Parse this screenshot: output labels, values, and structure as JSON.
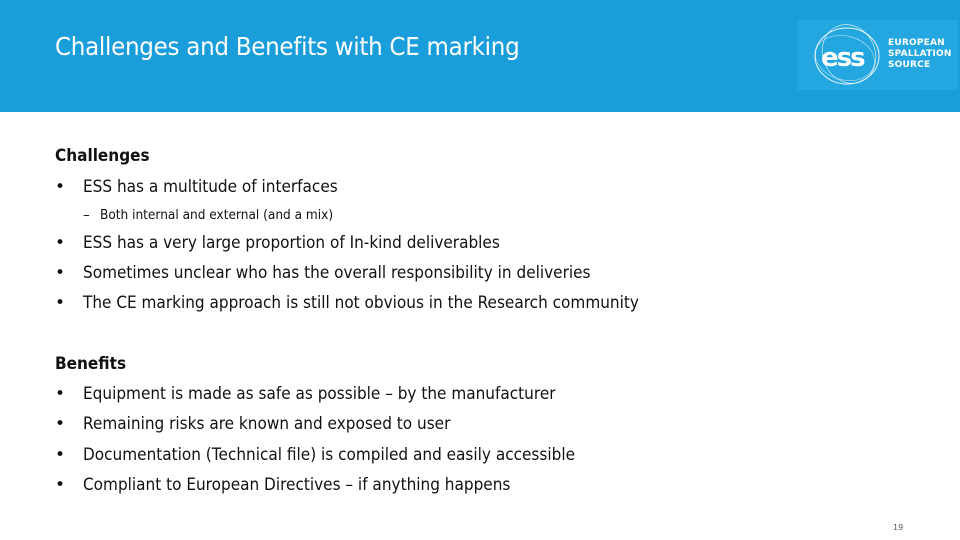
{
  "slide": {
    "title": "Challenges and Benefits with CE marking",
    "page_number": "19",
    "colors": {
      "header_bg": "#1a9edb",
      "logo_bg": "#24a6e0",
      "text": "#111111"
    }
  },
  "logo": {
    "mark": "ess",
    "lines": [
      "EUROPEAN",
      "SPALLATION",
      "SOURCE"
    ]
  },
  "challenges": {
    "heading": "Challenges",
    "items": [
      {
        "text": "ESS has a multitude of interfaces",
        "sub": [
          "Both internal and external (and a mix)"
        ]
      },
      {
        "text": "ESS has a very large proportion of In-kind deliverables"
      },
      {
        "text": "Sometimes unclear who has the overall responsibility in deliveries"
      },
      {
        "text": "The CE marking approach is still not obvious in the Research community"
      }
    ]
  },
  "benefits": {
    "heading": "Benefits",
    "items": [
      {
        "text": "Equipment is made as safe as possible – by the manufacturer"
      },
      {
        "text": "Remaining risks are known and exposed to user"
      },
      {
        "text": "Documentation (Technical file) is compiled and easily accessible"
      },
      {
        "text": "Compliant to European Directives – if anything happens"
      }
    ]
  },
  "glyphs": {
    "bullet": "•",
    "dash": "–"
  }
}
